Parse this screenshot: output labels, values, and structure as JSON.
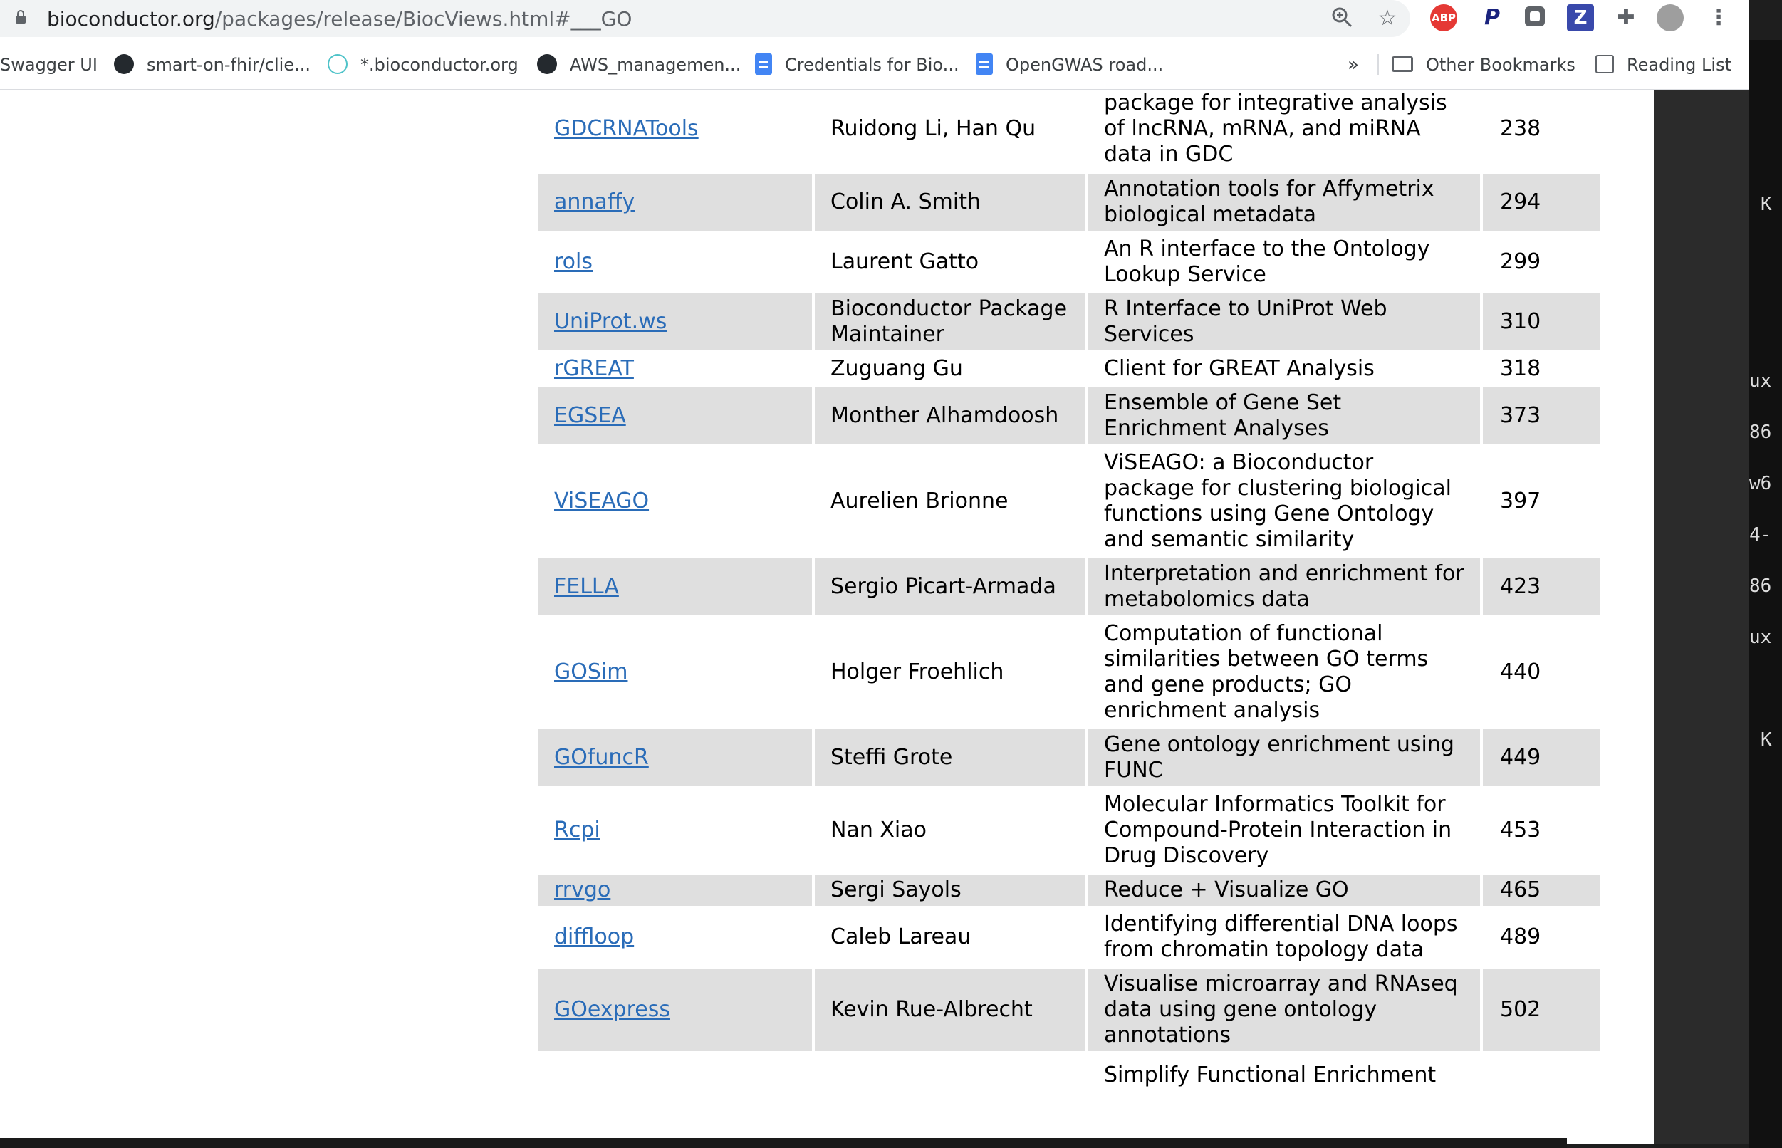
{
  "browser": {
    "url_host": "bioconductor.org",
    "url_path": "/packages/release/BiocViews.html#___GO",
    "bookmarks": [
      "Swagger UI",
      "smart-on-fhir/clie...",
      "*.bioconductor.org",
      "AWS_managemen...",
      "Credentials for Bio...",
      "OpenGWAS road..."
    ],
    "overflow_chevron": "»",
    "other_bookmarks": "Other Bookmarks",
    "reading_list": "Reading List",
    "extensions": [
      "ABP",
      "P",
      "Z"
    ]
  },
  "terminal_fragments": [
    "K",
    "ux",
    "86",
    "w6",
    "4-",
    "86",
    "ux",
    "K"
  ],
  "table": {
    "rows": [
      {
        "package": "GDCRNATools",
        "maintainer": "Ruidong Li, Han Qu",
        "title": "package for integrative analysis of lncRNA, mRNA, and miRNA data in GDC",
        "rank": "238"
      },
      {
        "package": "annaffy",
        "maintainer": "Colin A. Smith",
        "title": "Annotation tools for Affymetrix biological metadata",
        "rank": "294"
      },
      {
        "package": "rols",
        "maintainer": "Laurent Gatto",
        "title": "An R interface to the Ontology Lookup Service",
        "rank": "299"
      },
      {
        "package": "UniProt.ws",
        "maintainer": "Bioconductor Package Maintainer",
        "title": "R Interface to UniProt Web Services",
        "rank": "310"
      },
      {
        "package": "rGREAT",
        "maintainer": "Zuguang Gu",
        "title": "Client for GREAT Analysis",
        "rank": "318"
      },
      {
        "package": "EGSEA",
        "maintainer": "Monther Alhamdoosh",
        "title": "Ensemble of Gene Set Enrichment Analyses",
        "rank": "373"
      },
      {
        "package": "ViSEAGO",
        "maintainer": "Aurelien Brionne",
        "title": "ViSEAGO: a Bioconductor package for clustering biological functions using Gene Ontology and semantic similarity",
        "rank": "397"
      },
      {
        "package": "FELLA",
        "maintainer": "Sergio Picart-Armada",
        "title": "Interpretation and enrichment for metabolomics data",
        "rank": "423"
      },
      {
        "package": "GOSim",
        "maintainer": "Holger Froehlich",
        "title": "Computation of functional similarities between GO terms and gene products; GO enrichment analysis",
        "rank": "440"
      },
      {
        "package": "GOfuncR",
        "maintainer": "Steffi Grote",
        "title": "Gene ontology enrichment using FUNC",
        "rank": "449"
      },
      {
        "package": "Rcpi",
        "maintainer": "Nan Xiao",
        "title": "Molecular Informatics Toolkit for Compound-Protein Interaction in Drug Discovery",
        "rank": "453"
      },
      {
        "package": "rrvgo",
        "maintainer": "Sergi Sayols",
        "title": "Reduce + Visualize GO",
        "rank": "465"
      },
      {
        "package": "diffloop",
        "maintainer": "Caleb Lareau",
        "title": "Identifying differential DNA loops from chromatin topology data",
        "rank": "489"
      },
      {
        "package": "GOexpress",
        "maintainer": "Kevin Rue-Albrecht",
        "title": "Visualise microarray and RNAseq data using gene ontology annotations",
        "rank": "502"
      },
      {
        "package": "",
        "maintainer": "",
        "title": "Simplify Functional Enrichment",
        "rank": ""
      }
    ]
  }
}
